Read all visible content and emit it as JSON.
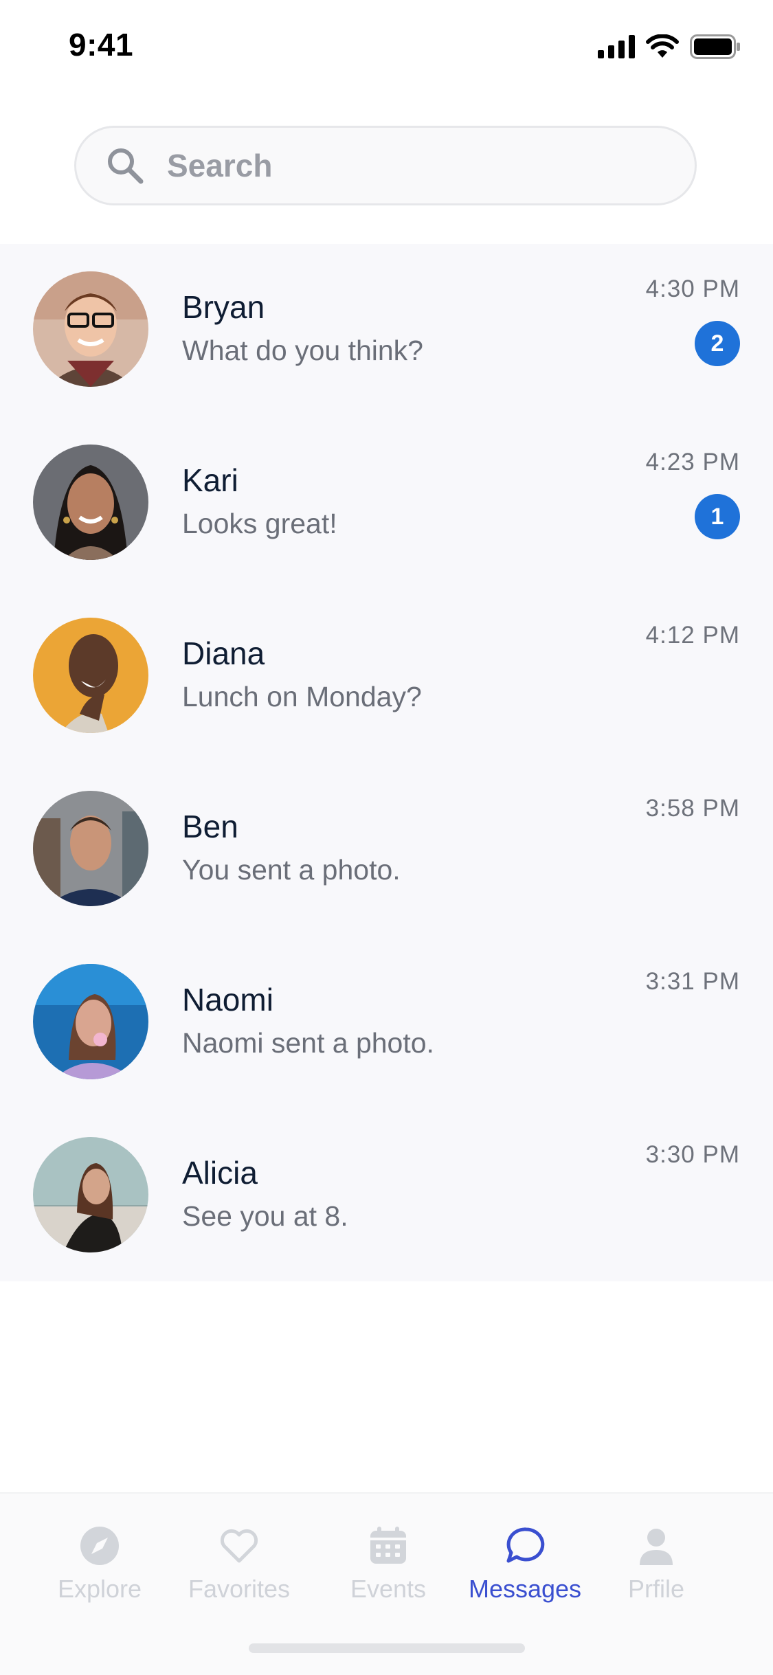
{
  "status_bar": {
    "time": "9:41"
  },
  "search": {
    "placeholder": "Search"
  },
  "conversations": [
    {
      "name": "Bryan",
      "preview": "What do you think?",
      "time": "4:30 PM",
      "unread": "2"
    },
    {
      "name": "Kari",
      "preview": "Looks great!",
      "time": "4:23 PM",
      "unread": "1"
    },
    {
      "name": "Diana",
      "preview": "Lunch on Monday?",
      "time": "4:12 PM",
      "unread": null
    },
    {
      "name": "Ben",
      "preview": "You sent a photo.",
      "time": "3:58 PM",
      "unread": null
    },
    {
      "name": "Naomi",
      "preview": "Naomi sent a photo.",
      "time": "3:31 PM",
      "unread": null
    },
    {
      "name": "Alicia",
      "preview": "See you at 8.",
      "time": "3:30 PM",
      "unread": null
    }
  ],
  "tabs": [
    {
      "label": "Explore",
      "icon": "compass-icon",
      "active": false
    },
    {
      "label": "Favorites",
      "icon": "heart-icon",
      "active": false
    },
    {
      "label": "Events",
      "icon": "calendar-icon",
      "active": false
    },
    {
      "label": "Messages",
      "icon": "message-icon",
      "active": true
    },
    {
      "label": "Prfile",
      "icon": "person-icon",
      "active": false
    }
  ],
  "colors": {
    "accent": "#3a4fd0",
    "badge": "#1f72d9",
    "list_background": "#f8f8fb",
    "inactive_tab": "#cfd2d8"
  }
}
